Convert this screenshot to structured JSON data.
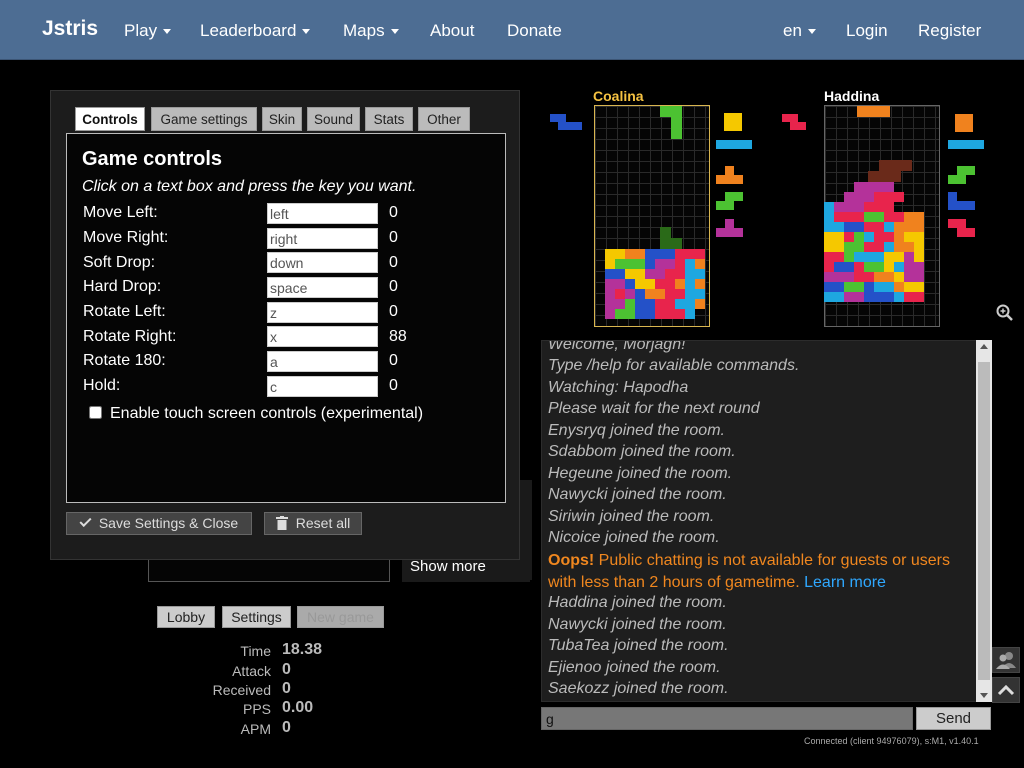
{
  "navbar": {
    "brand": "Jstris",
    "items": [
      "Play",
      "Leaderboard",
      "Maps",
      "About",
      "Donate"
    ],
    "lang": "en",
    "login": "Login",
    "register": "Register"
  },
  "settings": {
    "tabs": [
      "Controls",
      "Game settings",
      "Skin",
      "Sound",
      "Stats",
      "Other"
    ],
    "title": "Game controls",
    "subtitle": "Click on a text box and press the key you want.",
    "controls": [
      {
        "label": "Move Left:",
        "key": "left",
        "code": "0"
      },
      {
        "label": "Move Right:",
        "key": "right",
        "code": "0"
      },
      {
        "label": "Soft Drop:",
        "key": "down",
        "code": "0"
      },
      {
        "label": "Hard Drop:",
        "key": "space",
        "code": "0"
      },
      {
        "label": "Rotate Left:",
        "key": "z",
        "code": "0"
      },
      {
        "label": "Rotate Right:",
        "key": "x",
        "code": "88"
      },
      {
        "label": "Rotate 180:",
        "key": "a",
        "code": "0"
      },
      {
        "label": "Hold:",
        "key": "c",
        "code": "0"
      }
    ],
    "touch_label": "Enable touch screen controls (experimental)",
    "save_label": "Save Settings & Close",
    "reset_label": "Reset all"
  },
  "show_more": "Show more",
  "buttons": {
    "lobby": "Lobby",
    "settings": "Settings",
    "new_game": "New game"
  },
  "stats": [
    {
      "label": "Time",
      "value": "18.38"
    },
    {
      "label": "Attack",
      "value": "0"
    },
    {
      "label": "Received",
      "value": "0"
    },
    {
      "label": "PPS",
      "value": "0.00"
    },
    {
      "label": "APM",
      "value": "0"
    }
  ],
  "players": [
    {
      "name": "Coalina",
      "name_color": "#f5c242"
    },
    {
      "name": "Haddina",
      "name_color": "#ffffff"
    }
  ],
  "chat": {
    "messages": [
      "Welcome, Morjagh!",
      "Type /help for available commands.",
      "Watching: Hapodha",
      "Please wait for the next round",
      "Enysryq joined the room.",
      "Sdabbom joined the room.",
      "Hegeune joined the room.",
      "Nawycki joined the room.",
      "Siriwin joined the room.",
      "Nicoice joined the room."
    ],
    "warning_prefix": "Oops!",
    "warning_text": " Public chatting is not available for guests or users with less than 2 hours of gametime. ",
    "warning_link": "Learn more",
    "messages_after": [
      "Haddina joined the room.",
      "Nawycki joined the room.",
      "TubaTea joined the room.",
      "Ejienoo joined the room.",
      "Saekozz joined the room."
    ],
    "input_value": "g",
    "send_label": "Send"
  },
  "status": "Connected (client 94976079), s:M1, v1.40.1",
  "colors": {
    "navbar": "#4d6d93",
    "warning": "#f0871f",
    "link": "#2fa8ff"
  }
}
